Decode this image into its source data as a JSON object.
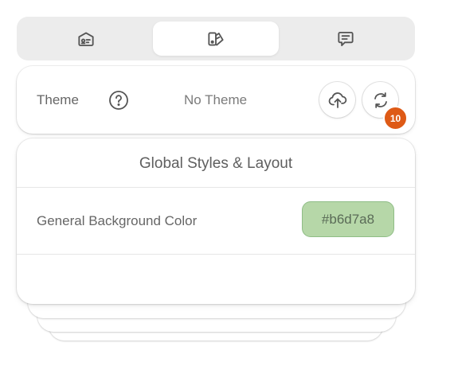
{
  "tabs": [
    {
      "label": "",
      "icon": "settings-card-icon",
      "active": false
    },
    {
      "label": "",
      "icon": "theme-palette-icon",
      "active": true
    },
    {
      "label": "",
      "icon": "chat-bubble-icon",
      "active": false
    }
  ],
  "theme": {
    "label": "Theme",
    "value": "No Theme",
    "help_icon": "help-circle-icon",
    "upload_icon": "cloud-upload-icon",
    "refresh_icon": "refresh-sync-icon",
    "badge_count": "10",
    "badge_color": "#de5a16"
  },
  "global": {
    "title": "Global Styles & Layout",
    "rows": [
      {
        "label": "General Background Color",
        "value": "#b6d7a8",
        "swatch": "#b6d7a8"
      }
    ]
  }
}
